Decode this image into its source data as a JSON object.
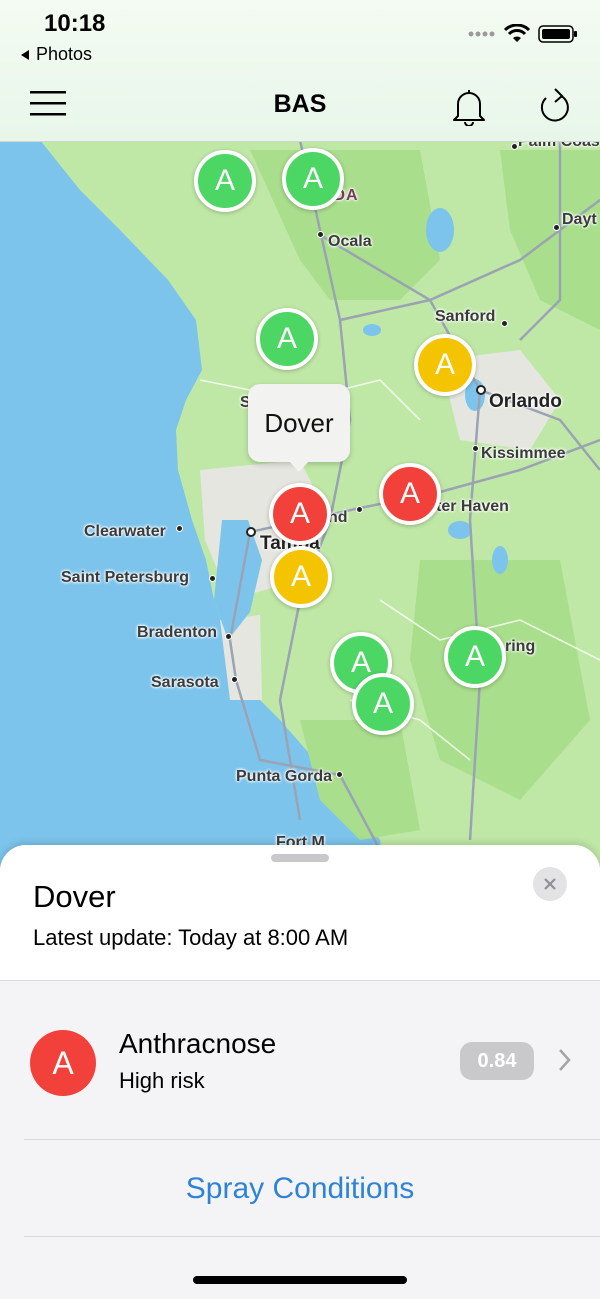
{
  "status": {
    "time": "10:18",
    "back_app": "Photos"
  },
  "header": {
    "title": "BAS"
  },
  "map": {
    "state_label": "IDA",
    "cities": {
      "palm_coast": "Palm Coas",
      "dayt": "Dayt",
      "ocala": "Ocala",
      "sanford": "Sanford",
      "orlando": "Orlando",
      "kissimmee": "Kissimmee",
      "winter_haven": "ter Haven",
      "plant_city": "nd",
      "clearwater": "Clearwater",
      "tampa": "Tampa",
      "saint_petersburg": "Saint Petersburg",
      "bradenton": "Bradenton",
      "sarasota": "Sarasota",
      "sebring": "ring",
      "punta_gorda": "Punta Gorda",
      "fort_myers": "Fort M",
      "s": "S"
    },
    "markers": [
      {
        "letter": "A",
        "risk": "low"
      },
      {
        "letter": "A",
        "risk": "low"
      },
      {
        "letter": "A",
        "risk": "low"
      },
      {
        "letter": "A",
        "risk": "medium"
      },
      {
        "letter": "A",
        "risk": "high"
      },
      {
        "letter": "A",
        "risk": "high"
      },
      {
        "letter": "A",
        "risk": "medium"
      },
      {
        "letter": "A",
        "risk": "low"
      },
      {
        "letter": "A",
        "risk": "low"
      },
      {
        "letter": "A",
        "risk": "low"
      }
    ],
    "callout": "Dover"
  },
  "risk_colors": {
    "low": "#4cd664",
    "medium": "#f5c400",
    "high": "#f2403a"
  },
  "sheet": {
    "title": "Dover",
    "subtitle": "Latest update: Today at 8:00 AM",
    "disease": {
      "letter": "A",
      "name": "Anthracnose",
      "risk": "High risk",
      "score": "0.84"
    },
    "spray_label": "Spray Conditions"
  }
}
